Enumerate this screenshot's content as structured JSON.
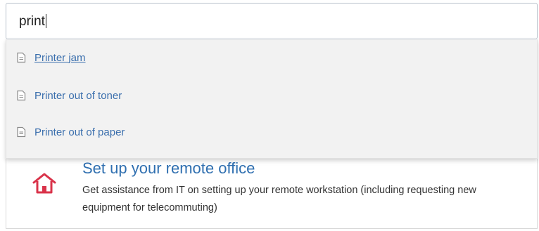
{
  "search": {
    "value": "print"
  },
  "suggestions": [
    {
      "label": "Printer jam",
      "icon": "document-icon"
    },
    {
      "label": "Printer out of toner",
      "icon": "document-icon"
    },
    {
      "label": "Printer out of paper",
      "icon": "document-icon"
    }
  ],
  "card": {
    "icon": "home-icon",
    "icon_color": "#d9334a",
    "title": "Set up your remote office",
    "description": "Get assistance from IT on setting up your remote workstation (including requesting new equipment for telecommuting)"
  },
  "colors": {
    "link": "#3b6fad",
    "title": "#2f6fb0"
  }
}
